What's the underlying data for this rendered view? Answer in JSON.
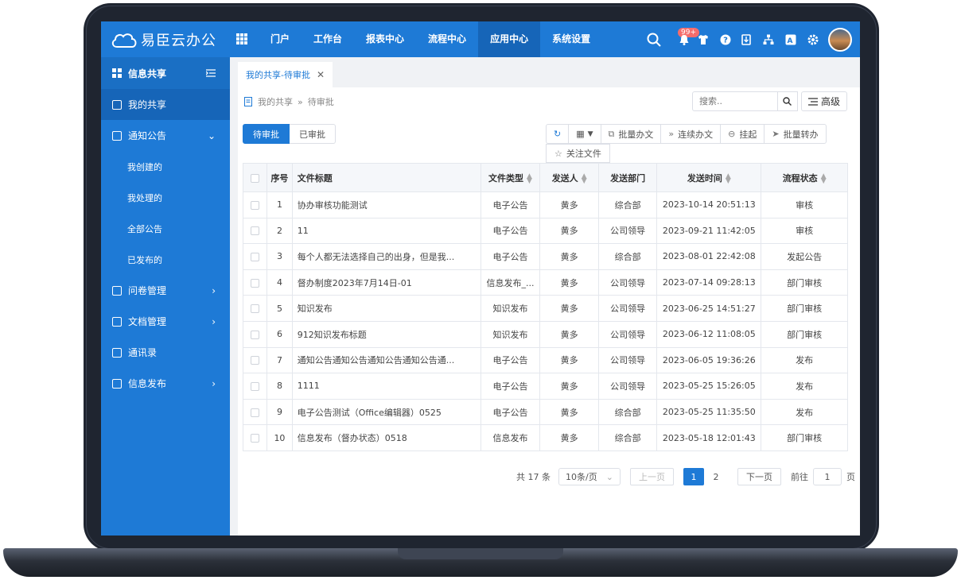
{
  "app": {
    "name": "易臣云办公"
  },
  "header": {
    "nav": [
      "门户",
      "工作台",
      "报表中心",
      "流程中心",
      "应用中心",
      "系统设置"
    ],
    "active_nav": "应用中心",
    "notification_badge": "99+"
  },
  "sidebar": {
    "header": "信息共享",
    "items": [
      {
        "label": "我的共享"
      },
      {
        "label": "通知公告"
      },
      {
        "label": "我创建的"
      },
      {
        "label": "我处理的"
      },
      {
        "label": "全部公告"
      },
      {
        "label": "已发布的"
      },
      {
        "label": "问卷管理"
      },
      {
        "label": "文档管理"
      },
      {
        "label": "通讯录"
      },
      {
        "label": "信息发布"
      }
    ]
  },
  "tab": {
    "label": "我的共享-待审批"
  },
  "breadcrumb": [
    "我的共享",
    "待审批"
  ],
  "search": {
    "placeholder": "搜索.."
  },
  "advanced_label": "高级",
  "segments": [
    "待审批",
    "已审批"
  ],
  "toolbar": [
    "批量办文",
    "连续办文",
    "挂起",
    "批量转办"
  ],
  "follow_label": "关注文件",
  "table": {
    "columns": [
      "序号",
      "文件标题",
      "文件类型",
      "发送人",
      "发送部门",
      "发送时间",
      "流程状态"
    ],
    "rows": [
      [
        "1",
        "协办审核功能测试",
        "电子公告",
        "黄多",
        "综合部",
        "2023-10-14 20:51:13",
        "审核"
      ],
      [
        "2",
        "11",
        "电子公告",
        "黄多",
        "公司领导",
        "2023-09-21 11:42:05",
        "审核"
      ],
      [
        "3",
        "每个人都无法选择自己的出身，但是我...",
        "电子公告",
        "黄多",
        "综合部",
        "2023-08-01 22:42:08",
        "发起公告"
      ],
      [
        "4",
        "督办制度2023年7月14日-01",
        "信息发布_...",
        "黄多",
        "公司领导",
        "2023-07-14 09:28:13",
        "部门审核"
      ],
      [
        "5",
        "知识发布",
        "知识发布",
        "黄多",
        "公司领导",
        "2023-06-25 14:51:27",
        "部门审核"
      ],
      [
        "6",
        "912知识发布标题",
        "知识发布",
        "黄多",
        "公司领导",
        "2023-06-12 11:08:05",
        "部门审核"
      ],
      [
        "7",
        "通知公告通知公告通知公告通知公告通...",
        "电子公告",
        "黄多",
        "公司领导",
        "2023-06-05 19:36:26",
        "发布"
      ],
      [
        "8",
        "1111",
        "电子公告",
        "黄多",
        "公司领导",
        "2023-05-25 15:26:05",
        "发布"
      ],
      [
        "9",
        "电子公告测试（Office编辑器）0525",
        "电子公告",
        "黄多",
        "综合部",
        "2023-05-25 11:35:50",
        "发布"
      ],
      [
        "10",
        "信息发布（督办状态）0518",
        "信息发布",
        "黄多",
        "综合部",
        "2023-05-18 12:01:43",
        "部门审核"
      ]
    ]
  },
  "pagination": {
    "total": "共 17 条",
    "page_size": "10条/页",
    "prev": "上一页",
    "pages": [
      "1",
      "2"
    ],
    "current": "1",
    "next": "下一页",
    "goto_prefix": "前往",
    "goto_value": "1",
    "goto_suffix": "页"
  }
}
